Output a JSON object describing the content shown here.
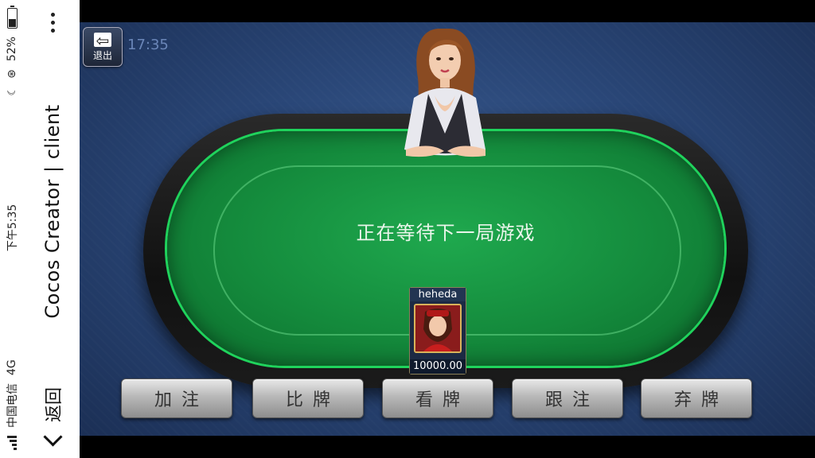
{
  "status_bar": {
    "carrier": "中国电信",
    "network": "4G",
    "time": "下午5:35",
    "battery": "52%",
    "battery_fraction": 0.52
  },
  "title_bar": {
    "back_label": "返回",
    "title": "Cocos Creator | client"
  },
  "game": {
    "exit_label": "退出",
    "clock": "17:35",
    "table_message": "正在等待下一局游戏",
    "player": {
      "name": "heheda",
      "chips": "10000.00"
    },
    "actions": [
      "加注",
      "比牌",
      "看牌",
      "跟注",
      "弃牌"
    ]
  }
}
